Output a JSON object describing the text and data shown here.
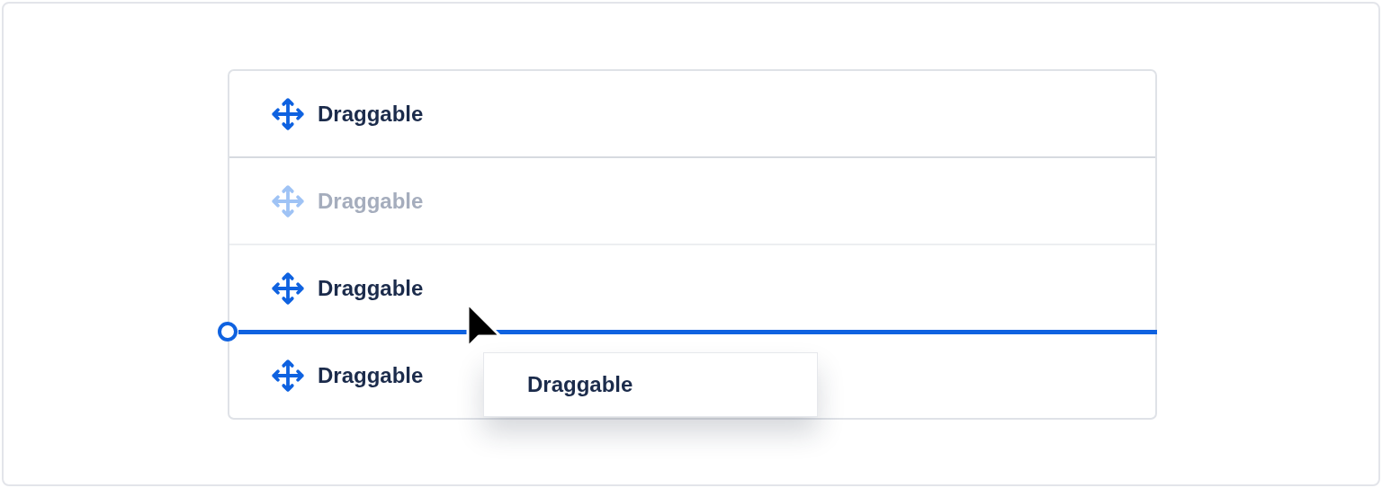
{
  "list": {
    "items": [
      {
        "label": "Draggable",
        "dragging": false,
        "drop_before": false
      },
      {
        "label": "Draggable",
        "dragging": true,
        "drop_before": false
      },
      {
        "label": "Draggable",
        "dragging": false,
        "drop_before": false
      },
      {
        "label": "Draggable",
        "dragging": false,
        "drop_before": true
      }
    ]
  },
  "drag_preview": {
    "label": "Draggable"
  }
}
